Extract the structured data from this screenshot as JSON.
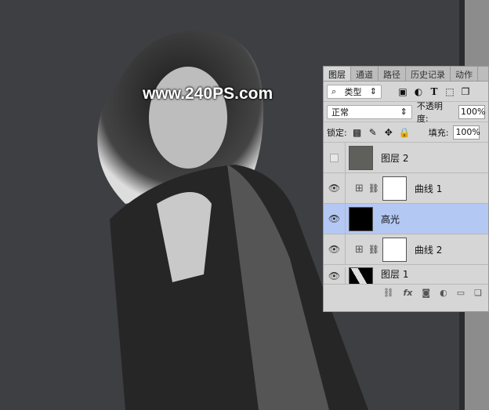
{
  "watermark": "www.240PS.com",
  "panel": {
    "tabs": [
      "图层",
      "通道",
      "路径",
      "历史记录",
      "动作"
    ],
    "filter_kind": "类型",
    "filter_icons": [
      "image-filter-icon",
      "adjustment-filter-icon",
      "type-filter-icon",
      "shape-filter-icon",
      "smart-object-filter-icon"
    ],
    "blend_mode": "正常",
    "opacity_label": "不透明度:",
    "opacity": "100%",
    "lock_label": "锁定:",
    "fill_label": "填充:",
    "fill": "100%",
    "layers": [
      {
        "name": "图层 2",
        "visible": false,
        "type": "fill",
        "thumb_color": "#5f5f5c"
      },
      {
        "name": "曲线 1",
        "visible": true,
        "type": "curves"
      },
      {
        "name": "高光",
        "visible": true,
        "type": "image",
        "selected": true
      },
      {
        "name": "曲线 2",
        "visible": true,
        "type": "curves"
      },
      {
        "name": "图层 1",
        "visible": true,
        "type": "image"
      }
    ],
    "selected_color": "#b4c8f4"
  }
}
